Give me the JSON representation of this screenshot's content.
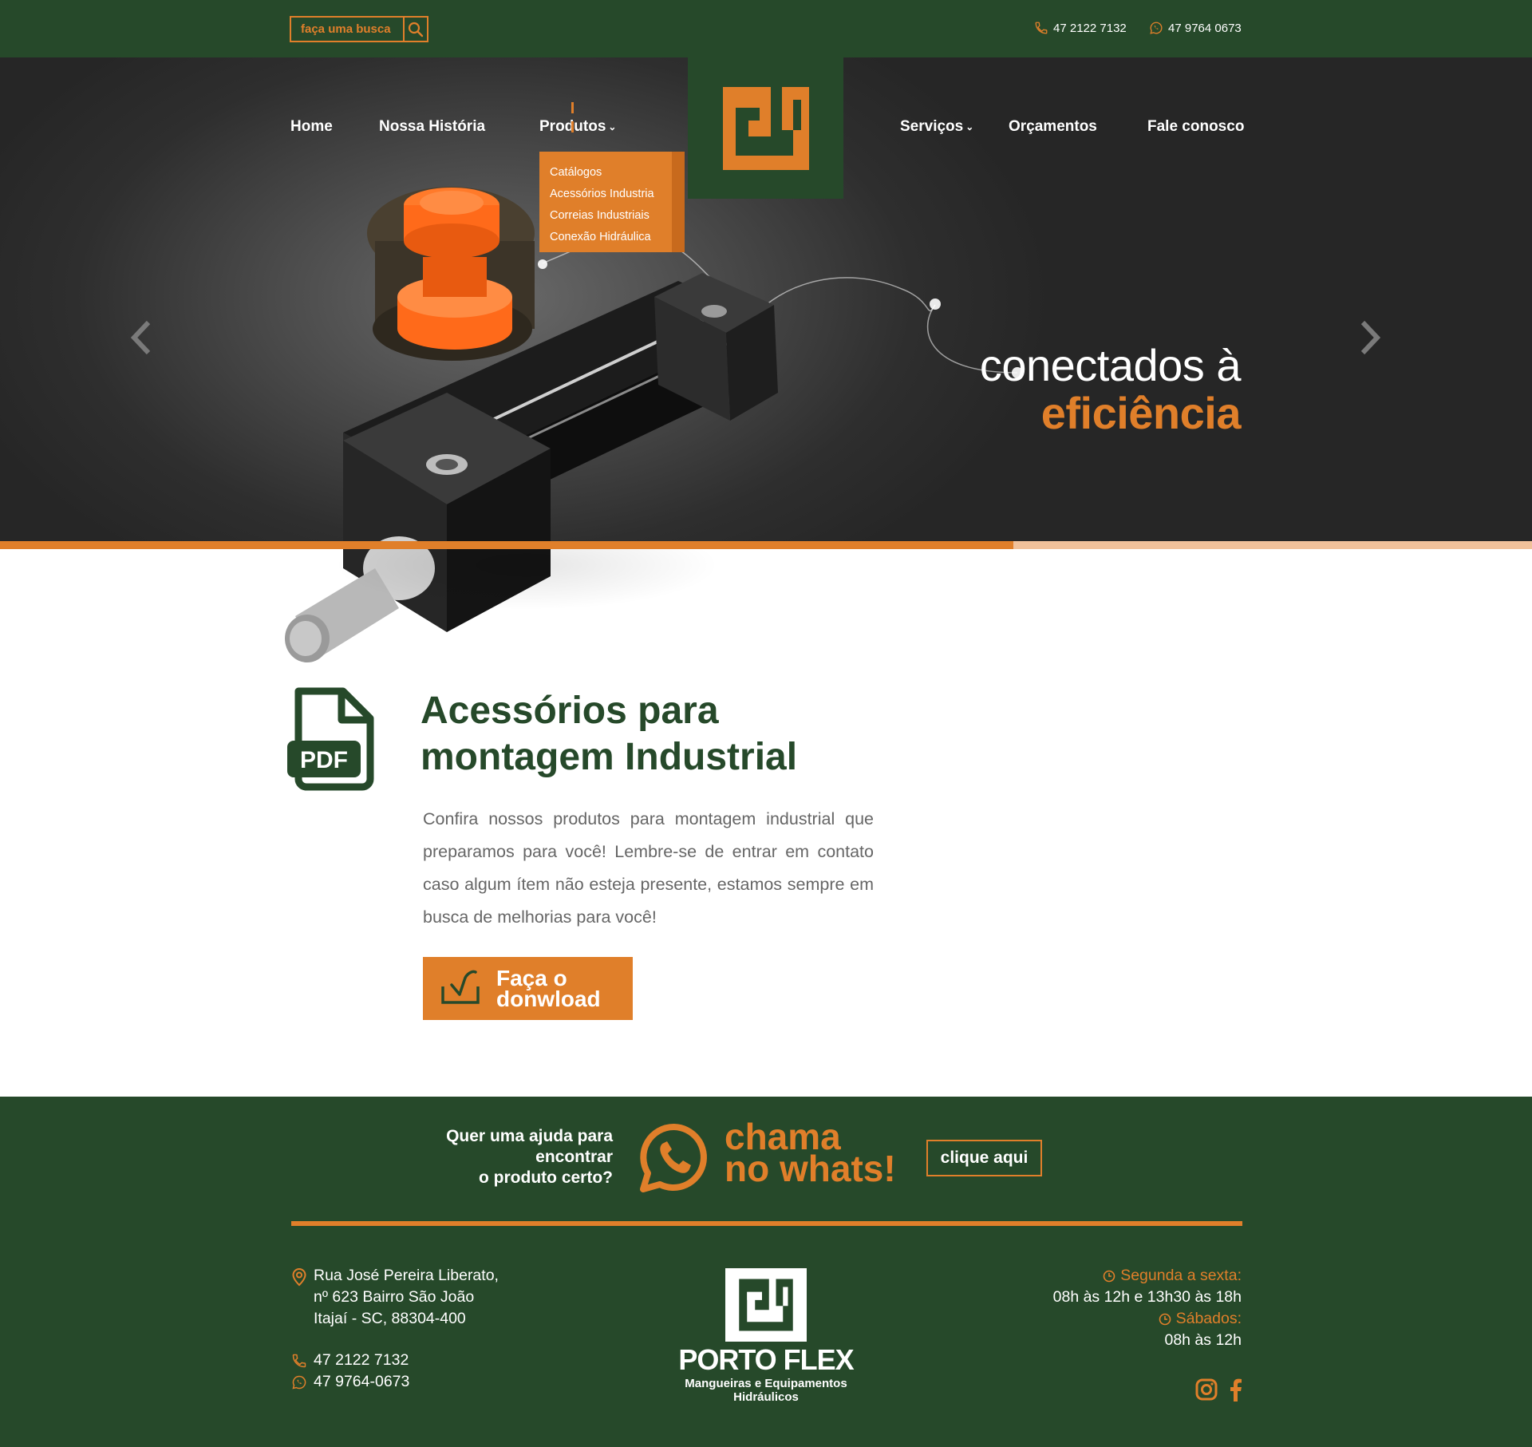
{
  "colors": {
    "green": "#26492a",
    "orange": "#e07f2a",
    "orange_light": "#f1c19a",
    "text_gray": "#666666"
  },
  "topbar": {
    "search_placeholder": "faça uma busca",
    "search_icon": "search-icon",
    "phone": "47 2122 7132",
    "whatsapp": "47 9764 0673"
  },
  "nav": {
    "home": "Home",
    "historia": "Nossa História",
    "produtos": "Produtos",
    "servicos": "Serviços",
    "orcamentos": "Orçamentos",
    "fale": "Fale conosco",
    "active": "Produtos"
  },
  "dropdown": {
    "items": [
      "Catálogos",
      "Acessórios Industria",
      "Correias Industriais",
      "Conexão Hidráulica"
    ]
  },
  "hero": {
    "tagline_line1": "conectados à",
    "tagline_line2": "eficiência"
  },
  "content": {
    "title": "Acessórios para montagem Industrial",
    "pdf_label": "PDF",
    "text": "Confira nossos produtos para montagem industrial que preparamos para você! Lembre-se de entrar em contato caso algum ítem não esteja presente, estamos sempre em busca de melhorias para você!",
    "download_label": "Faça o donwload"
  },
  "footer": {
    "help_line1": "Quer uma ajuda para",
    "help_line2": "encontrar",
    "help_line3": "o produto certo?",
    "chama_line1": "chama",
    "chama_line2": "no whats!",
    "clique": "clique aqui",
    "address_line1": "Rua José Pereira Liberato,",
    "address_line2": "nº 623 Bairro São João",
    "address_line3": "Itajaí - SC, 88304-400",
    "phone": "47 2122 7132",
    "whatsapp": "47 9764-0673",
    "brand": "PORTO FLEX",
    "brand_sub1": "Mangueiras e Equipamentos",
    "brand_sub2": "Hidráulicos",
    "hours_label1": "Segunda a sexta:",
    "hours_val1": "08h às 12h e 13h30 às 18h",
    "hours_label2": "Sábados:",
    "hours_val2": "08h às 12h"
  }
}
